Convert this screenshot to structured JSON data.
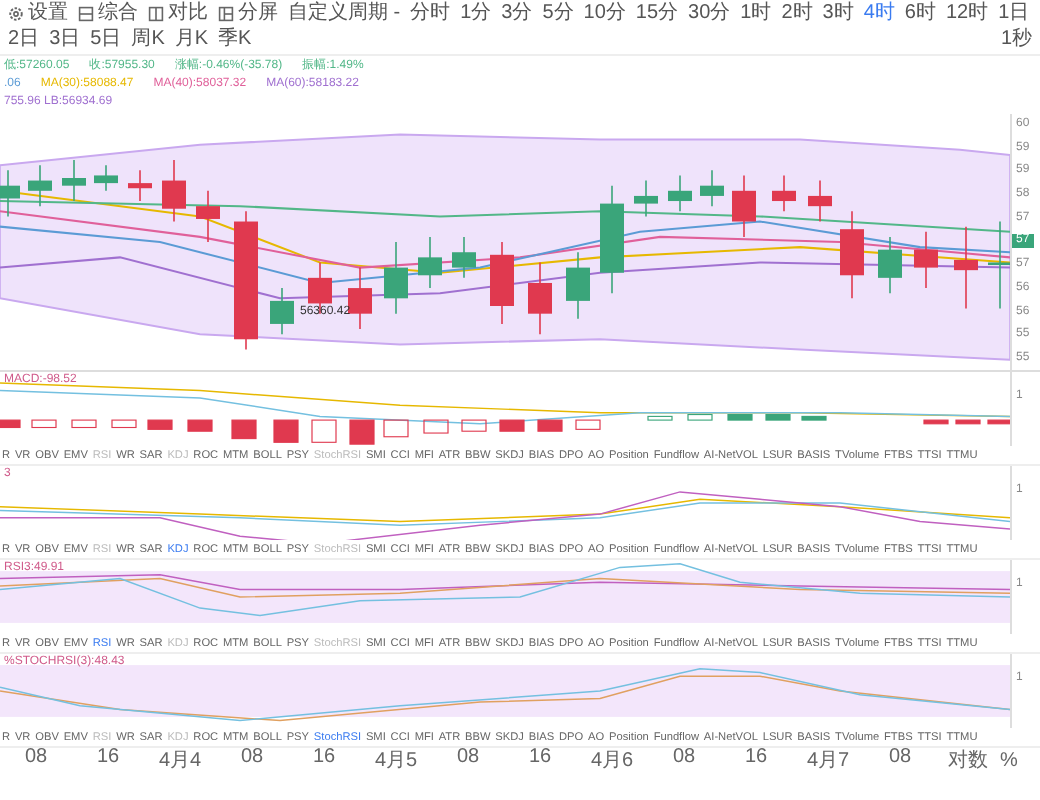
{
  "toolbar": {
    "tools": [
      {
        "kind": "settings",
        "label": "设置"
      },
      {
        "kind": "grid",
        "label": "综合"
      },
      {
        "kind": "compare",
        "label": "对比"
      },
      {
        "kind": "split",
        "label": "分屏"
      }
    ],
    "custom_period": "自定义周期 -",
    "periods": [
      {
        "label": "分时",
        "selected": false
      },
      {
        "label": "1分",
        "selected": false
      },
      {
        "label": "3分",
        "selected": false
      },
      {
        "label": "5分",
        "selected": false
      },
      {
        "label": "10分",
        "selected": false
      },
      {
        "label": "15分",
        "selected": false
      },
      {
        "label": "30分",
        "selected": false
      },
      {
        "label": "1时",
        "selected": false
      },
      {
        "label": "2时",
        "selected": false
      },
      {
        "label": "3时",
        "selected": false
      },
      {
        "label": "4时",
        "selected": true
      },
      {
        "label": "6时",
        "selected": false
      },
      {
        "label": "12时",
        "selected": false
      },
      {
        "label": "1日",
        "selected": false
      },
      {
        "label": "2日",
        "selected": false
      },
      {
        "label": "3日",
        "selected": false
      },
      {
        "label": "5日",
        "selected": false
      },
      {
        "label": "周K",
        "selected": false
      },
      {
        "label": "月K",
        "selected": false
      },
      {
        "label": "季K",
        "selected": false
      }
    ],
    "right_label": "1秒"
  },
  "info": {
    "line_1": [
      {
        "text": "低:57260.05",
        "color": "#52b788"
      },
      {
        "text": "收:57955.30",
        "color": "#52b788"
      },
      {
        "text": "涨幅:-0.46%(-35.78)",
        "color": "#52b788"
      },
      {
        "text": "振幅:1.49%",
        "color": "#52b788"
      }
    ],
    "line_2": [
      {
        "text": ".06",
        "color": "#5b9bd5"
      },
      {
        "text": "MA(30):58088.47",
        "color": "#e6b800"
      },
      {
        "text": "MA(40):58037.32",
        "color": "#e0609a"
      },
      {
        "text": "MA(60):58183.22",
        "color": "#a070d0"
      }
    ],
    "line_3": [
      {
        "text": "755.96  LB:56934.69",
        "color": "#a070d0"
      }
    ]
  },
  "main_chart": {
    "price_axis": [
      "60",
      "59",
      "59",
      "58",
      "57",
      "57",
      "56",
      "56",
      "55",
      "55"
    ],
    "low_label": "56360.42",
    "last_price": "57"
  },
  "panels": [
    {
      "kind": "macd",
      "label": "MACD:-98.52",
      "axis": "1",
      "tabs": [
        {
          "label": "R",
          "selected": false,
          "dimmed": false
        },
        {
          "label": "VR",
          "selected": false,
          "dimmed": false
        },
        {
          "label": "OBV",
          "selected": false,
          "dimmed": false
        },
        {
          "label": "EMV",
          "selected": false,
          "dimmed": false
        },
        {
          "label": "RSI",
          "selected": false,
          "dimmed": true
        },
        {
          "label": "WR",
          "selected": false,
          "dimmed": false
        },
        {
          "label": "SAR",
          "selected": false,
          "dimmed": false
        },
        {
          "label": "KDJ",
          "selected": false,
          "dimmed": true
        },
        {
          "label": "ROC",
          "selected": false,
          "dimmed": false
        },
        {
          "label": "MTM",
          "selected": false,
          "dimmed": false
        },
        {
          "label": "BOLL",
          "selected": false,
          "dimmed": false
        },
        {
          "label": "PSY",
          "selected": false,
          "dimmed": false
        },
        {
          "label": "StochRSI",
          "selected": false,
          "dimmed": true
        },
        {
          "label": "SMI",
          "selected": false,
          "dimmed": false
        },
        {
          "label": "CCI",
          "selected": false,
          "dimmed": false
        },
        {
          "label": "MFI",
          "selected": false,
          "dimmed": false
        },
        {
          "label": "ATR",
          "selected": false,
          "dimmed": false
        },
        {
          "label": "BBW",
          "selected": false,
          "dimmed": false
        },
        {
          "label": "SKDJ",
          "selected": false,
          "dimmed": false
        },
        {
          "label": "BIAS",
          "selected": false,
          "dimmed": false
        },
        {
          "label": "DPO",
          "selected": false,
          "dimmed": false
        },
        {
          "label": "AO",
          "selected": false,
          "dimmed": false
        },
        {
          "label": "Position",
          "selected": false,
          "dimmed": false
        },
        {
          "label": "Fundflow",
          "selected": false,
          "dimmed": false
        },
        {
          "label": "AI-NetVOL",
          "selected": false,
          "dimmed": false
        },
        {
          "label": "LSUR",
          "selected": false,
          "dimmed": false
        },
        {
          "label": "BASIS",
          "selected": false,
          "dimmed": false
        },
        {
          "label": "TVolume",
          "selected": false,
          "dimmed": false
        },
        {
          "label": "FTBS",
          "selected": false,
          "dimmed": false
        },
        {
          "label": "TTSI",
          "selected": false,
          "dimmed": false
        },
        {
          "label": "TTMU",
          "selected": false,
          "dimmed": false
        }
      ]
    },
    {
      "kind": "kdj",
      "label": "3",
      "axis": "1",
      "tabs": [
        {
          "label": "R",
          "selected": false,
          "dimmed": false
        },
        {
          "label": "VR",
          "selected": false,
          "dimmed": false
        },
        {
          "label": "OBV",
          "selected": false,
          "dimmed": false
        },
        {
          "label": "EMV",
          "selected": false,
          "dimmed": false
        },
        {
          "label": "RSI",
          "selected": false,
          "dimmed": true
        },
        {
          "label": "WR",
          "selected": false,
          "dimmed": false
        },
        {
          "label": "SAR",
          "selected": false,
          "dimmed": false
        },
        {
          "label": "KDJ",
          "selected": true,
          "dimmed": false
        },
        {
          "label": "ROC",
          "selected": false,
          "dimmed": false
        },
        {
          "label": "MTM",
          "selected": false,
          "dimmed": false
        },
        {
          "label": "BOLL",
          "selected": false,
          "dimmed": false
        },
        {
          "label": "PSY",
          "selected": false,
          "dimmed": false
        },
        {
          "label": "StochRSI",
          "selected": false,
          "dimmed": true
        },
        {
          "label": "SMI",
          "selected": false,
          "dimmed": false
        },
        {
          "label": "CCI",
          "selected": false,
          "dimmed": false
        },
        {
          "label": "MFI",
          "selected": false,
          "dimmed": false
        },
        {
          "label": "ATR",
          "selected": false,
          "dimmed": false
        },
        {
          "label": "BBW",
          "selected": false,
          "dimmed": false
        },
        {
          "label": "SKDJ",
          "selected": false,
          "dimmed": false
        },
        {
          "label": "BIAS",
          "selected": false,
          "dimmed": false
        },
        {
          "label": "DPO",
          "selected": false,
          "dimmed": false
        },
        {
          "label": "AO",
          "selected": false,
          "dimmed": false
        },
        {
          "label": "Position",
          "selected": false,
          "dimmed": false
        },
        {
          "label": "Fundflow",
          "selected": false,
          "dimmed": false
        },
        {
          "label": "AI-NetVOL",
          "selected": false,
          "dimmed": false
        },
        {
          "label": "LSUR",
          "selected": false,
          "dimmed": false
        },
        {
          "label": "BASIS",
          "selected": false,
          "dimmed": false
        },
        {
          "label": "TVolume",
          "selected": false,
          "dimmed": false
        },
        {
          "label": "FTBS",
          "selected": false,
          "dimmed": false
        },
        {
          "label": "TTSI",
          "selected": false,
          "dimmed": false
        },
        {
          "label": "TTMU",
          "selected": false,
          "dimmed": false
        }
      ]
    },
    {
      "kind": "rsi",
      "label": "RSI3:49.91",
      "axis": "1",
      "tabs": [
        {
          "label": "R",
          "selected": false,
          "dimmed": false
        },
        {
          "label": "VR",
          "selected": false,
          "dimmed": false
        },
        {
          "label": "OBV",
          "selected": false,
          "dimmed": false
        },
        {
          "label": "EMV",
          "selected": false,
          "dimmed": false
        },
        {
          "label": "RSI",
          "selected": true,
          "dimmed": false
        },
        {
          "label": "WR",
          "selected": false,
          "dimmed": false
        },
        {
          "label": "SAR",
          "selected": false,
          "dimmed": false
        },
        {
          "label": "KDJ",
          "selected": false,
          "dimmed": true
        },
        {
          "label": "ROC",
          "selected": false,
          "dimmed": false
        },
        {
          "label": "MTM",
          "selected": false,
          "dimmed": false
        },
        {
          "label": "BOLL",
          "selected": false,
          "dimmed": false
        },
        {
          "label": "PSY",
          "selected": false,
          "dimmed": false
        },
        {
          "label": "StochRSI",
          "selected": false,
          "dimmed": true
        },
        {
          "label": "SMI",
          "selected": false,
          "dimmed": false
        },
        {
          "label": "CCI",
          "selected": false,
          "dimmed": false
        },
        {
          "label": "MFI",
          "selected": false,
          "dimmed": false
        },
        {
          "label": "ATR",
          "selected": false,
          "dimmed": false
        },
        {
          "label": "BBW",
          "selected": false,
          "dimmed": false
        },
        {
          "label": "SKDJ",
          "selected": false,
          "dimmed": false
        },
        {
          "label": "BIAS",
          "selected": false,
          "dimmed": false
        },
        {
          "label": "DPO",
          "selected": false,
          "dimmed": false
        },
        {
          "label": "AO",
          "selected": false,
          "dimmed": false
        },
        {
          "label": "Position",
          "selected": false,
          "dimmed": false
        },
        {
          "label": "Fundflow",
          "selected": false,
          "dimmed": false
        },
        {
          "label": "AI-NetVOL",
          "selected": false,
          "dimmed": false
        },
        {
          "label": "LSUR",
          "selected": false,
          "dimmed": false
        },
        {
          "label": "BASIS",
          "selected": false,
          "dimmed": false
        },
        {
          "label": "TVolume",
          "selected": false,
          "dimmed": false
        },
        {
          "label": "FTBS",
          "selected": false,
          "dimmed": false
        },
        {
          "label": "TTSI",
          "selected": false,
          "dimmed": false
        },
        {
          "label": "TTMU",
          "selected": false,
          "dimmed": false
        }
      ]
    },
    {
      "kind": "stochrsi",
      "label": "%STOCHRSI(3):48.43",
      "axis": "1",
      "tabs": [
        {
          "label": "R",
          "selected": false,
          "dimmed": false
        },
        {
          "label": "VR",
          "selected": false,
          "dimmed": false
        },
        {
          "label": "OBV",
          "selected": false,
          "dimmed": false
        },
        {
          "label": "EMV",
          "selected": false,
          "dimmed": false
        },
        {
          "label": "RSI",
          "selected": false,
          "dimmed": true
        },
        {
          "label": "WR",
          "selected": false,
          "dimmed": false
        },
        {
          "label": "SAR",
          "selected": false,
          "dimmed": false
        },
        {
          "label": "KDJ",
          "selected": false,
          "dimmed": true
        },
        {
          "label": "ROC",
          "selected": false,
          "dimmed": false
        },
        {
          "label": "MTM",
          "selected": false,
          "dimmed": false
        },
        {
          "label": "BOLL",
          "selected": false,
          "dimmed": false
        },
        {
          "label": "PSY",
          "selected": false,
          "dimmed": false
        },
        {
          "label": "StochRSI",
          "selected": true,
          "dimmed": false
        },
        {
          "label": "SMI",
          "selected": false,
          "dimmed": false
        },
        {
          "label": "CCI",
          "selected": false,
          "dimmed": false
        },
        {
          "label": "MFI",
          "selected": false,
          "dimmed": false
        },
        {
          "label": "ATR",
          "selected": false,
          "dimmed": false
        },
        {
          "label": "BBW",
          "selected": false,
          "dimmed": false
        },
        {
          "label": "SKDJ",
          "selected": false,
          "dimmed": false
        },
        {
          "label": "BIAS",
          "selected": false,
          "dimmed": false
        },
        {
          "label": "DPO",
          "selected": false,
          "dimmed": false
        },
        {
          "label": "AO",
          "selected": false,
          "dimmed": false
        },
        {
          "label": "Position",
          "selected": false,
          "dimmed": false
        },
        {
          "label": "Fundflow",
          "selected": false,
          "dimmed": false
        },
        {
          "label": "AI-NetVOL",
          "selected": false,
          "dimmed": false
        },
        {
          "label": "LSUR",
          "selected": false,
          "dimmed": false
        },
        {
          "label": "BASIS",
          "selected": false,
          "dimmed": false
        },
        {
          "label": "TVolume",
          "selected": false,
          "dimmed": false
        },
        {
          "label": "FTBS",
          "selected": false,
          "dimmed": false
        },
        {
          "label": "TTSI",
          "selected": false,
          "dimmed": false
        },
        {
          "label": "TTMU",
          "selected": false,
          "dimmed": false
        }
      ]
    }
  ],
  "time_axis": [
    "08",
    "16",
    "4月4",
    "08",
    "16",
    "4月5",
    "08",
    "16",
    "4月6",
    "08",
    "16",
    "4月7",
    "08"
  ],
  "axis_options": [
    "对数",
    "%"
  ]
}
